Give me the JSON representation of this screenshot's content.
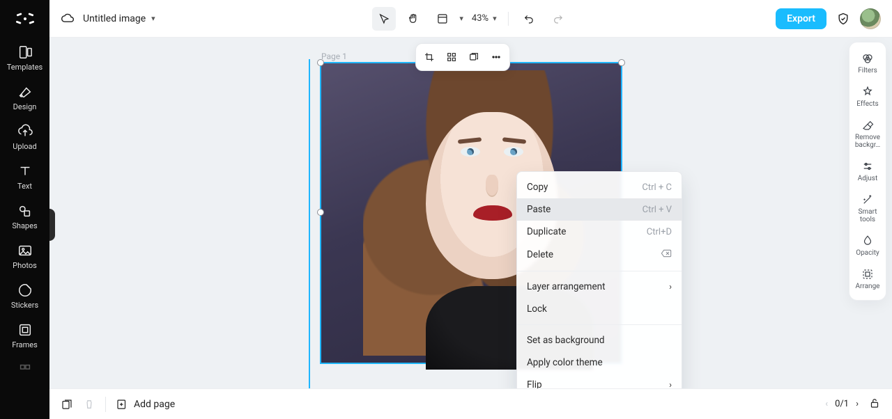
{
  "leftSidebar": {
    "items": [
      {
        "label": "Templates"
      },
      {
        "label": "Design"
      },
      {
        "label": "Upload"
      },
      {
        "label": "Text"
      },
      {
        "label": "Shapes"
      },
      {
        "label": "Photos"
      },
      {
        "label": "Stickers"
      },
      {
        "label": "Frames"
      }
    ]
  },
  "topbar": {
    "title": "Untitled image",
    "zoom": "43%",
    "export": "Export"
  },
  "canvas": {
    "pageLabel": "Page 1"
  },
  "contextMenu": {
    "items": [
      {
        "label": "Copy",
        "shortcut": "Ctrl + C"
      },
      {
        "label": "Paste",
        "shortcut": "Ctrl + V",
        "hover": true
      },
      {
        "label": "Duplicate",
        "shortcut": "Ctrl+D"
      },
      {
        "label": "Delete",
        "iconRight": "backspace"
      }
    ],
    "group2": [
      {
        "label": "Layer arrangement",
        "arrow": true
      },
      {
        "label": "Lock"
      }
    ],
    "group3": [
      {
        "label": "Set as background"
      },
      {
        "label": "Apply color theme"
      },
      {
        "label": "Flip",
        "arrow": true
      }
    ]
  },
  "rightBar": {
    "items": [
      {
        "label": "Filters"
      },
      {
        "label": "Effects"
      },
      {
        "label": "Remove backgr…"
      },
      {
        "label": "Adjust"
      },
      {
        "label": "Smart tools"
      },
      {
        "label": "Opacity"
      },
      {
        "label": "Arrange"
      }
    ]
  },
  "bottombar": {
    "addPage": "Add page",
    "pageCounter": "0/1"
  }
}
